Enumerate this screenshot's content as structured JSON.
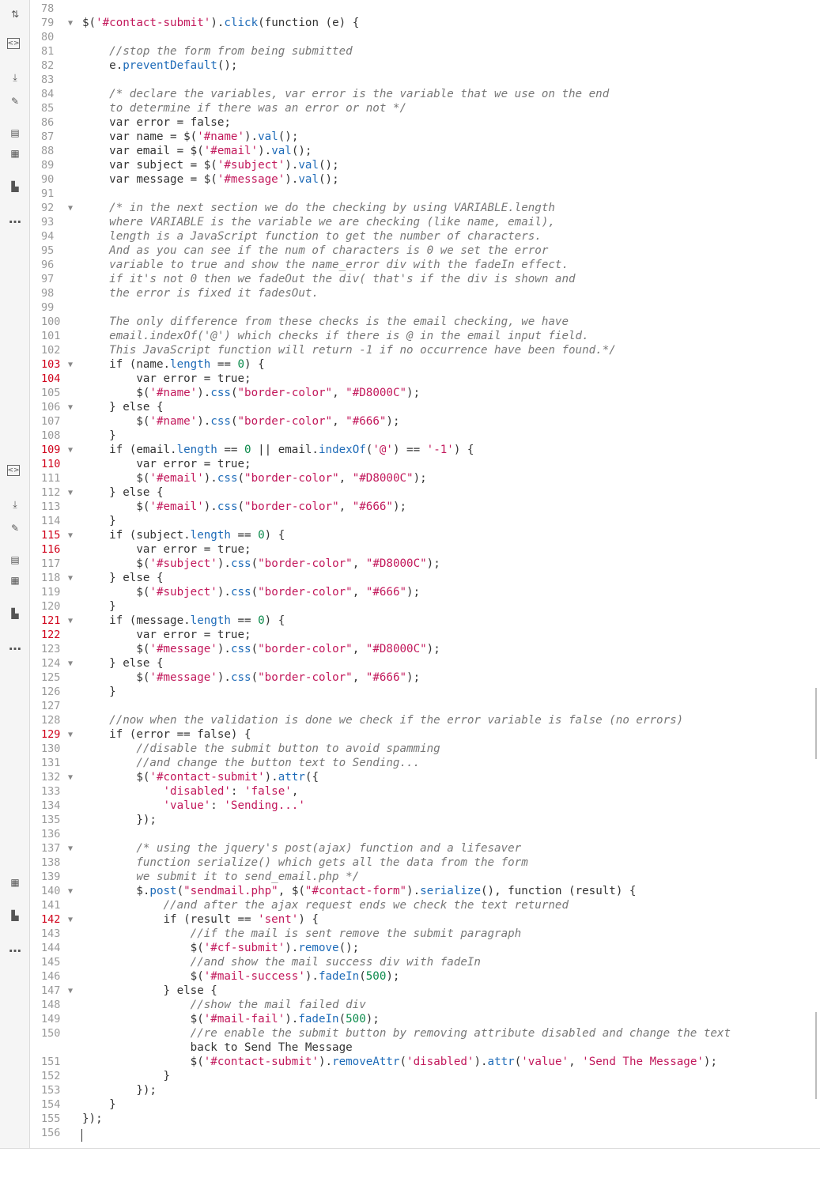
{
  "sidebar": {
    "tools_top": [
      {
        "icon": "sort-icon",
        "glyph": "⇅"
      },
      {
        "icon": "code-block-icon",
        "glyph": "<>"
      },
      {
        "icon": "insert-icon",
        "glyph": "⤓"
      },
      {
        "icon": "link-icon",
        "glyph": "✎"
      },
      {
        "icon": "comment-icon",
        "glyph": "▤"
      },
      {
        "icon": "template-icon",
        "glyph": "▦"
      },
      {
        "icon": "chart-icon",
        "glyph": "▙"
      },
      {
        "icon": "more-icon",
        "glyph": "…"
      }
    ],
    "tools_mid": [
      {
        "icon": "code-block-icon",
        "glyph": "<>"
      },
      {
        "icon": "insert-icon",
        "glyph": "⤓"
      },
      {
        "icon": "link-icon",
        "glyph": "✎"
      },
      {
        "icon": "comment-icon",
        "glyph": "▤"
      },
      {
        "icon": "template-icon",
        "glyph": "▦"
      },
      {
        "icon": "chart-icon",
        "glyph": "▙"
      },
      {
        "icon": "more-icon",
        "glyph": "…"
      }
    ],
    "tools_bottom": [
      {
        "icon": "template-icon",
        "glyph": "▦"
      },
      {
        "icon": "chart-icon",
        "glyph": "▙"
      },
      {
        "icon": "more-icon",
        "glyph": "…"
      }
    ]
  },
  "code": {
    "lines": [
      {
        "n": "78",
        "fold": false,
        "red": false,
        "text": ""
      },
      {
        "n": "79",
        "fold": true,
        "red": false,
        "text": "$('#contact-submit').click(function (e) {"
      },
      {
        "n": "80",
        "fold": false,
        "red": false,
        "text": ""
      },
      {
        "n": "81",
        "fold": false,
        "red": false,
        "text": "    //stop the form from being submitted"
      },
      {
        "n": "82",
        "fold": false,
        "red": false,
        "text": "    e.preventDefault();"
      },
      {
        "n": "83",
        "fold": false,
        "red": false,
        "text": ""
      },
      {
        "n": "84",
        "fold": false,
        "red": false,
        "text": "    /* declare the variables, var error is the variable that we use on the end"
      },
      {
        "n": "85",
        "fold": false,
        "red": false,
        "text": "    to determine if there was an error or not */"
      },
      {
        "n": "86",
        "fold": false,
        "red": false,
        "text": "    var error = false;"
      },
      {
        "n": "87",
        "fold": false,
        "red": false,
        "text": "    var name = $('#name').val();"
      },
      {
        "n": "88",
        "fold": false,
        "red": false,
        "text": "    var email = $('#email').val();"
      },
      {
        "n": "89",
        "fold": false,
        "red": false,
        "text": "    var subject = $('#subject').val();"
      },
      {
        "n": "90",
        "fold": false,
        "red": false,
        "text": "    var message = $('#message').val();"
      },
      {
        "n": "91",
        "fold": false,
        "red": false,
        "text": ""
      },
      {
        "n": "92",
        "fold": true,
        "red": false,
        "text": "    /* in the next section we do the checking by using VARIABLE.length"
      },
      {
        "n": "93",
        "fold": false,
        "red": false,
        "text": "    where VARIABLE is the variable we are checking (like name, email),"
      },
      {
        "n": "94",
        "fold": false,
        "red": false,
        "text": "    length is a JavaScript function to get the number of characters."
      },
      {
        "n": "95",
        "fold": false,
        "red": false,
        "text": "    And as you can see if the num of characters is 0 we set the error"
      },
      {
        "n": "96",
        "fold": false,
        "red": false,
        "text": "    variable to true and show the name_error div with the fadeIn effect."
      },
      {
        "n": "97",
        "fold": false,
        "red": false,
        "text": "    if it's not 0 then we fadeOut the div( that's if the div is shown and"
      },
      {
        "n": "98",
        "fold": false,
        "red": false,
        "text": "    the error is fixed it fadesOut."
      },
      {
        "n": "99",
        "fold": false,
        "red": false,
        "text": ""
      },
      {
        "n": "100",
        "fold": false,
        "red": false,
        "text": "    The only difference from these checks is the email checking, we have"
      },
      {
        "n": "101",
        "fold": false,
        "red": false,
        "text": "    email.indexOf('@') which checks if there is @ in the email input field."
      },
      {
        "n": "102",
        "fold": false,
        "red": false,
        "text": "    This JavaScript function will return -1 if no occurrence have been found.*/"
      },
      {
        "n": "103",
        "fold": true,
        "red": true,
        "text": "    if (name.length == 0) {"
      },
      {
        "n": "104",
        "fold": false,
        "red": true,
        "text": "        var error = true;"
      },
      {
        "n": "105",
        "fold": false,
        "red": false,
        "text": "        $('#name').css(\"border-color\", \"#D8000C\");"
      },
      {
        "n": "106",
        "fold": true,
        "red": false,
        "text": "    } else {"
      },
      {
        "n": "107",
        "fold": false,
        "red": false,
        "text": "        $('#name').css(\"border-color\", \"#666\");"
      },
      {
        "n": "108",
        "fold": false,
        "red": false,
        "text": "    }"
      },
      {
        "n": "109",
        "fold": true,
        "red": true,
        "text": "    if (email.length == 0 || email.indexOf('@') == '-1') {"
      },
      {
        "n": "110",
        "fold": false,
        "red": true,
        "text": "        var error = true;"
      },
      {
        "n": "111",
        "fold": false,
        "red": false,
        "text": "        $('#email').css(\"border-color\", \"#D8000C\");"
      },
      {
        "n": "112",
        "fold": true,
        "red": false,
        "text": "    } else {"
      },
      {
        "n": "113",
        "fold": false,
        "red": false,
        "text": "        $('#email').css(\"border-color\", \"#666\");"
      },
      {
        "n": "114",
        "fold": false,
        "red": false,
        "text": "    }"
      },
      {
        "n": "115",
        "fold": true,
        "red": true,
        "text": "    if (subject.length == 0) {"
      },
      {
        "n": "116",
        "fold": false,
        "red": true,
        "text": "        var error = true;"
      },
      {
        "n": "117",
        "fold": false,
        "red": false,
        "text": "        $('#subject').css(\"border-color\", \"#D8000C\");"
      },
      {
        "n": "118",
        "fold": true,
        "red": false,
        "text": "    } else {"
      },
      {
        "n": "119",
        "fold": false,
        "red": false,
        "text": "        $('#subject').css(\"border-color\", \"#666\");"
      },
      {
        "n": "120",
        "fold": false,
        "red": false,
        "text": "    }"
      },
      {
        "n": "121",
        "fold": true,
        "red": true,
        "text": "    if (message.length == 0) {"
      },
      {
        "n": "122",
        "fold": false,
        "red": true,
        "text": "        var error = true;"
      },
      {
        "n": "123",
        "fold": false,
        "red": false,
        "text": "        $('#message').css(\"border-color\", \"#D8000C\");"
      },
      {
        "n": "124",
        "fold": true,
        "red": false,
        "text": "    } else {"
      },
      {
        "n": "125",
        "fold": false,
        "red": false,
        "text": "        $('#message').css(\"border-color\", \"#666\");"
      },
      {
        "n": "126",
        "fold": false,
        "red": false,
        "text": "    }"
      },
      {
        "n": "127",
        "fold": false,
        "red": false,
        "text": ""
      },
      {
        "n": "128",
        "fold": false,
        "red": false,
        "text": "    //now when the validation is done we check if the error variable is false (no errors)"
      },
      {
        "n": "129",
        "fold": true,
        "red": true,
        "text": "    if (error == false) {"
      },
      {
        "n": "130",
        "fold": false,
        "red": false,
        "text": "        //disable the submit button to avoid spamming"
      },
      {
        "n": "131",
        "fold": false,
        "red": false,
        "text": "        //and change the button text to Sending..."
      },
      {
        "n": "132",
        "fold": true,
        "red": false,
        "text": "        $('#contact-submit').attr({"
      },
      {
        "n": "133",
        "fold": false,
        "red": false,
        "text": "            'disabled': 'false',"
      },
      {
        "n": "134",
        "fold": false,
        "red": false,
        "text": "            'value': 'Sending...'"
      },
      {
        "n": "135",
        "fold": false,
        "red": false,
        "text": "        });"
      },
      {
        "n": "136",
        "fold": false,
        "red": false,
        "text": ""
      },
      {
        "n": "137",
        "fold": true,
        "red": false,
        "text": "        /* using the jquery's post(ajax) function and a lifesaver"
      },
      {
        "n": "138",
        "fold": false,
        "red": false,
        "text": "        function serialize() which gets all the data from the form"
      },
      {
        "n": "139",
        "fold": false,
        "red": false,
        "text": "        we submit it to send_email.php */"
      },
      {
        "n": "140",
        "fold": true,
        "red": false,
        "text": "        $.post(\"sendmail.php\", $(\"#contact-form\").serialize(), function (result) {"
      },
      {
        "n": "141",
        "fold": false,
        "red": false,
        "text": "            //and after the ajax request ends we check the text returned"
      },
      {
        "n": "142",
        "fold": true,
        "red": true,
        "text": "            if (result == 'sent') {"
      },
      {
        "n": "143",
        "fold": false,
        "red": false,
        "text": "                //if the mail is sent remove the submit paragraph"
      },
      {
        "n": "144",
        "fold": false,
        "red": false,
        "text": "                $('#cf-submit').remove();"
      },
      {
        "n": "145",
        "fold": false,
        "red": false,
        "text": "                //and show the mail success div with fadeIn"
      },
      {
        "n": "146",
        "fold": false,
        "red": false,
        "text": "                $('#mail-success').fadeIn(500);"
      },
      {
        "n": "147",
        "fold": true,
        "red": false,
        "text": "            } else {"
      },
      {
        "n": "148",
        "fold": false,
        "red": false,
        "text": "                //show the mail failed div"
      },
      {
        "n": "149",
        "fold": false,
        "red": false,
        "text": "                $('#mail-fail').fadeIn(500);"
      },
      {
        "n": "150",
        "fold": false,
        "red": false,
        "text": "                //re enable the submit button by removing attribute disabled and change the text"
      },
      {
        "n": "",
        "fold": false,
        "red": false,
        "text": "                back to Send The Message"
      },
      {
        "n": "151",
        "fold": false,
        "red": false,
        "text": "                $('#contact-submit').removeAttr('disabled').attr('value', 'Send The Message');"
      },
      {
        "n": "152",
        "fold": false,
        "red": false,
        "text": "            }"
      },
      {
        "n": "153",
        "fold": false,
        "red": false,
        "text": "        });"
      },
      {
        "n": "154",
        "fold": false,
        "red": false,
        "text": "    }"
      },
      {
        "n": "155",
        "fold": false,
        "red": false,
        "text": "});"
      },
      {
        "n": "156",
        "fold": false,
        "red": false,
        "text": ""
      }
    ]
  },
  "colors": {
    "comment": "#777777",
    "string": "#c2185b",
    "keyword": "#1e6bb8",
    "number": "#0a8a4a",
    "line_number": "#999999",
    "line_number_error": "#d0021b"
  }
}
